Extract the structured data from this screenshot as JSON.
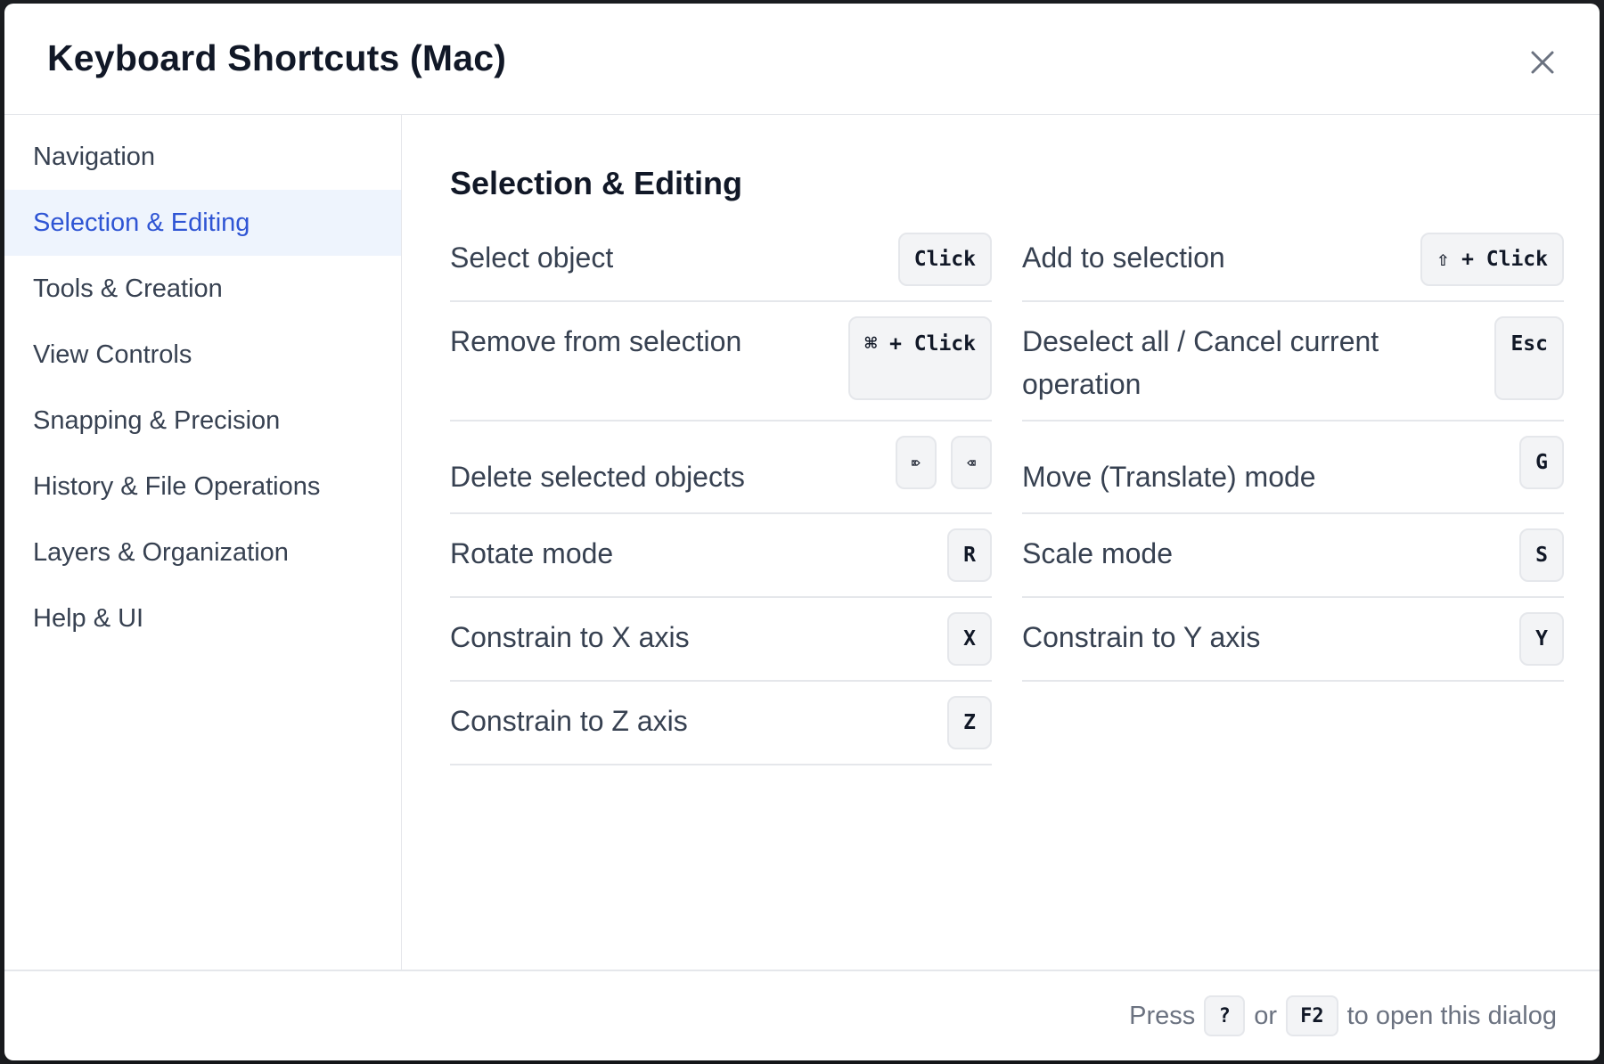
{
  "dialog": {
    "title": "Keyboard Shortcuts (Mac)",
    "close_icon": "close-icon"
  },
  "sidebar": {
    "items": [
      {
        "label": "Navigation"
      },
      {
        "label": "Selection & Editing",
        "active": true
      },
      {
        "label": "Tools & Creation"
      },
      {
        "label": "View Controls"
      },
      {
        "label": "Snapping & Precision"
      },
      {
        "label": "History & File Operations"
      },
      {
        "label": "Layers & Organization"
      },
      {
        "label": "Help & UI"
      }
    ]
  },
  "section": {
    "title": "Selection & Editing",
    "shortcuts": [
      {
        "label": "Select object",
        "keys": [
          "Click"
        ]
      },
      {
        "label": "Add to selection",
        "keys": [
          "⇧ + Click"
        ]
      },
      {
        "label": "Remove from selection",
        "keys": [
          "⌘ + Click"
        ]
      },
      {
        "label": "Deselect all / Cancel current operation",
        "keys": [
          "Esc"
        ]
      },
      {
        "label": "Delete selected objects",
        "keys": [
          "⌦",
          "⌫"
        ]
      },
      {
        "label": "Move (Translate) mode",
        "keys": [
          "G"
        ]
      },
      {
        "label": "Rotate mode",
        "keys": [
          "R"
        ]
      },
      {
        "label": "Scale mode",
        "keys": [
          "S"
        ]
      },
      {
        "label": "Constrain to X axis",
        "keys": [
          "X"
        ]
      },
      {
        "label": "Constrain to Y axis",
        "keys": [
          "Y"
        ]
      },
      {
        "label": "Constrain to Z axis",
        "keys": [
          "Z"
        ]
      }
    ]
  },
  "footer": {
    "press": "Press",
    "key1": "?",
    "or": "or",
    "key2": "F2",
    "suffix": "to open this dialog"
  },
  "colors": {
    "accent": "#2f55d4",
    "active_bg": "#eef4fd"
  }
}
